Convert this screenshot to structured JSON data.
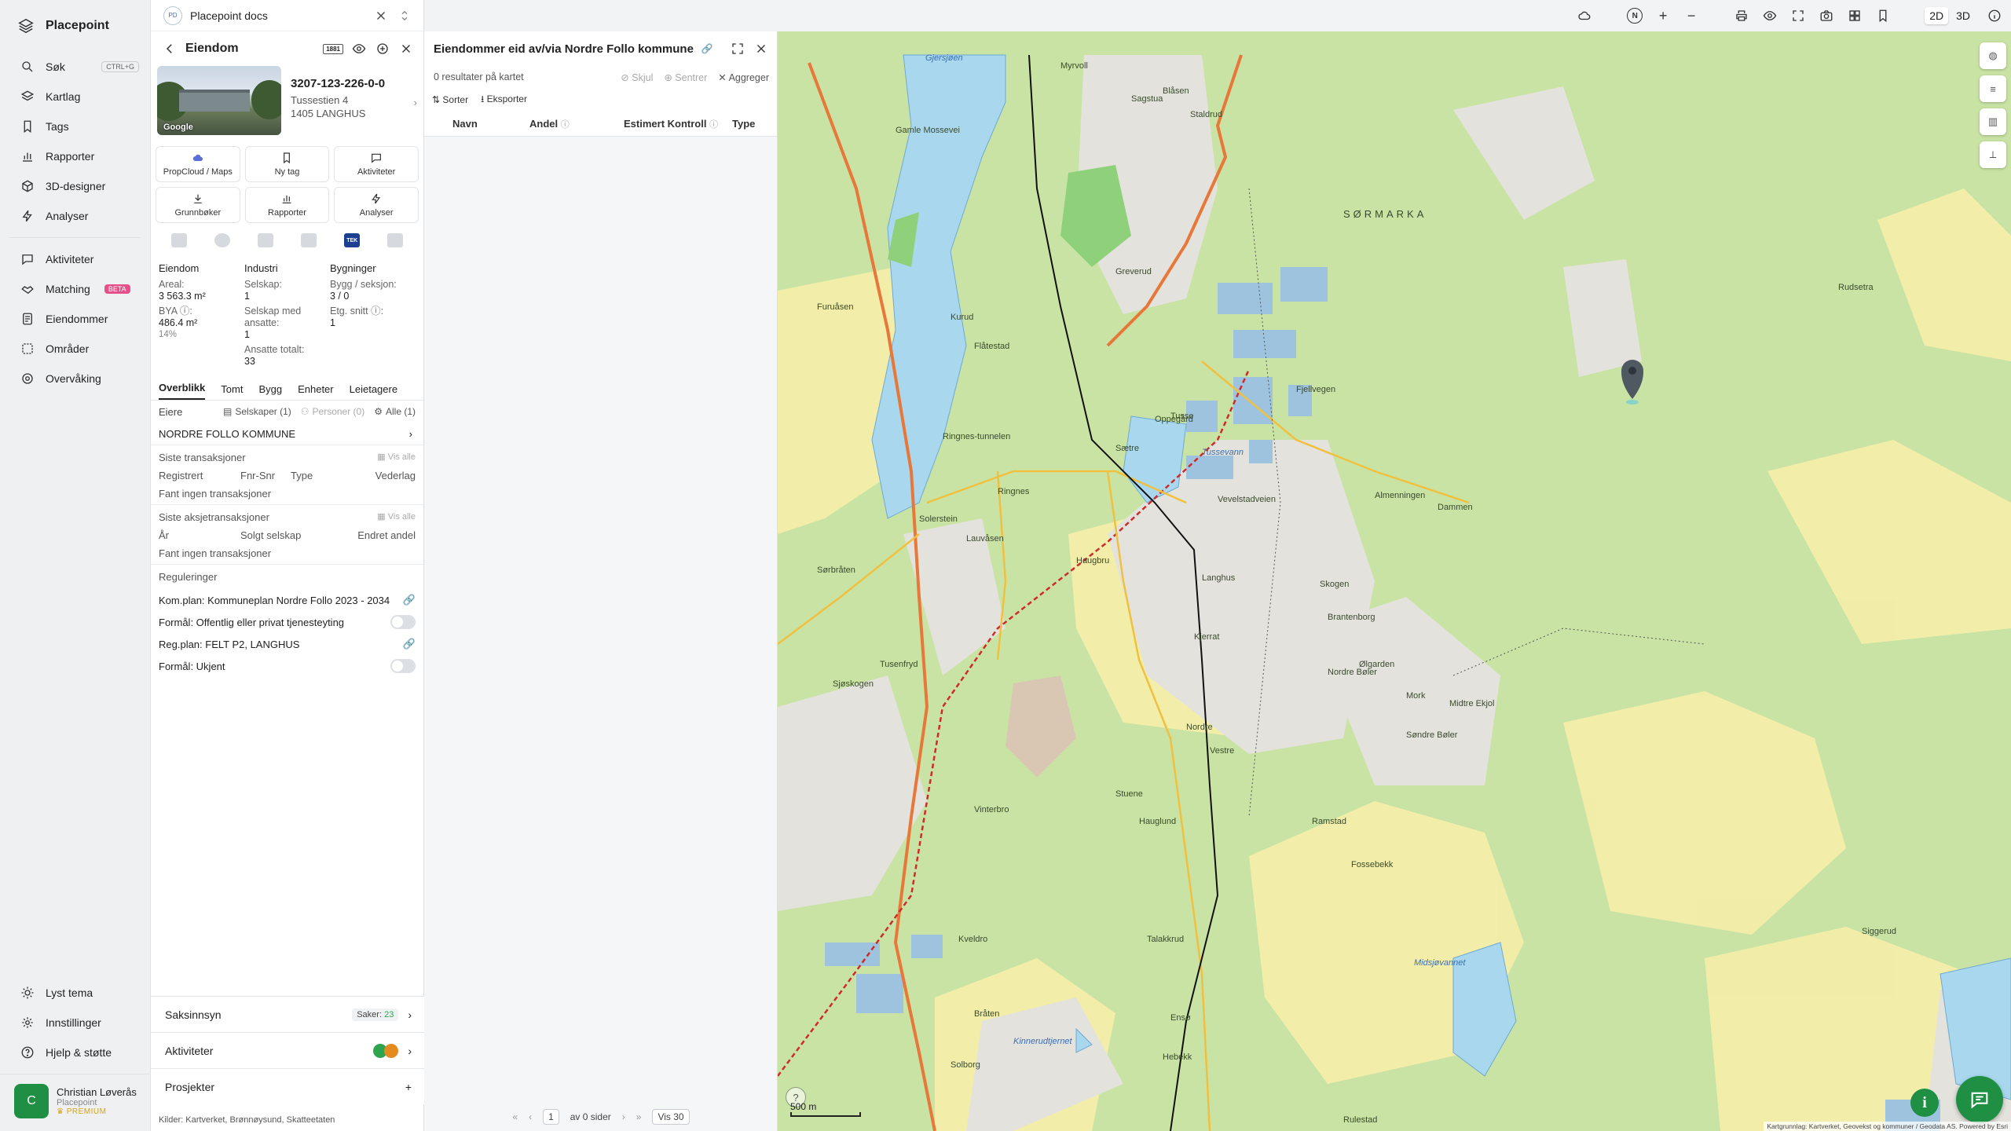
{
  "app": {
    "name": "Placepoint"
  },
  "nav": {
    "items": [
      {
        "label": "Søk",
        "shortcut": "CTRL+G"
      },
      {
        "label": "Kartlag"
      },
      {
        "label": "Tags"
      },
      {
        "label": "Rapporter"
      },
      {
        "label": "3D-designer"
      },
      {
        "label": "Analyser"
      },
      {
        "label": "Aktiviteter"
      },
      {
        "label": "Matching",
        "badge": "BETA"
      },
      {
        "label": "Eiendommer"
      },
      {
        "label": "Områder"
      },
      {
        "label": "Overvåking"
      }
    ],
    "bottom": [
      {
        "label": "Lyst tema"
      },
      {
        "label": "Innstillinger"
      },
      {
        "label": "Hjelp & støtte"
      }
    ],
    "user": {
      "initial": "C",
      "name": "Christian Løverås",
      "org": "Placepoint",
      "plan": "PREMIUM"
    }
  },
  "docsbar": {
    "logo": "PD",
    "title": "Placepoint docs"
  },
  "property": {
    "header": "Eiendom",
    "header_badge": "1881",
    "photo_credit": "Google",
    "id": "3207-123-226-0-0",
    "address_line1": "Tussestien 4",
    "address_line2": "1405 LANGHUS",
    "actions": [
      "PropCloud / Maps",
      "Ny tag",
      "Aktiviteter",
      "Grunnbøker",
      "Rapporter",
      "Analyser"
    ],
    "source_badge": "TEK",
    "stats": {
      "col1_header": "Eiendom",
      "col2_header": "Industri",
      "col3_header": "Bygninger",
      "areal_label": "Areal:",
      "areal_value": "3 563.3 m²",
      "bya_label": "BYA ⓘ:",
      "bya_value": "486.4 m²",
      "bya_pct": "14%",
      "selskap_label": "Selskap:",
      "selskap_value": "1",
      "selskap_ansatte_label": "Selskap med ansatte:",
      "selskap_ansatte_value": "1",
      "ansatte_label": "Ansatte totalt:",
      "ansatte_value": "33",
      "bygg_label": "Bygg / seksjon:",
      "bygg_value": "3 / 0",
      "etg_label": "Etg. snitt ⓘ:",
      "etg_value": "1"
    },
    "tabs": [
      "Overblikk",
      "Tomt",
      "Bygg",
      "Enheter",
      "Leietagere"
    ],
    "eiere": {
      "label": "Eiere",
      "f1": "Selskaper (1)",
      "f2": "Personer (0)",
      "f3": "Alle (1)",
      "owner": "NORDRE FOLLO KOMMUNE"
    },
    "transaksjoner": {
      "title": "Siste transaksjoner",
      "vis_alle": "Vis alle",
      "cols": [
        "Registrert",
        "Fnr-Snr",
        "Type",
        "Vederlag"
      ],
      "empty": "Fant ingen transaksjoner"
    },
    "aksjetransaksjoner": {
      "title": "Siste aksjetransaksjoner",
      "vis_alle": "Vis alle",
      "cols": [
        "År",
        "Solgt selskap",
        "Endret andel"
      ],
      "empty": "Fant ingen transaksjoner"
    },
    "reguleringer": {
      "title": "Reguleringer",
      "komplan": "Kom.plan: Kommuneplan Nordre Follo 2023 - 2034",
      "formal1": "Formål: Offentlig eller privat tjenesteyting",
      "regplan": "Reg.plan: FELT P2, LANGHUS",
      "formal2": "Formål: Ukjent"
    },
    "accordion": {
      "saksinnsyn": "Saksinnsyn",
      "saker_label": "Saker:",
      "saker_count": "23",
      "aktiviteter": "Aktiviteter",
      "prosjekter": "Prosjekter"
    },
    "kilder": {
      "label": "Kilder:",
      "sources": [
        "Kartverket,",
        "Brønnøysund,",
        "Skatteetaten"
      ]
    }
  },
  "results": {
    "title": "Eiendommer eid av/via Nordre Follo kommune",
    "count_text": "0 resultater på kartet",
    "skjul": "Skjul",
    "sentrer": "Sentrer",
    "aggreger": "Aggreger",
    "sorter": "Sorter",
    "eksporter": "Eksporter",
    "columns": [
      "Navn",
      "Andel",
      "Estimert Kontroll",
      "Type"
    ],
    "pager": {
      "page": "1",
      "of_text": "av 0 sider",
      "per_page": "Vis 30"
    }
  },
  "maptoolbar": {
    "north": "N",
    "mode_2d": "2D",
    "mode_3d": "3D"
  },
  "map": {
    "scale": "500 m",
    "attribution": "Kartgrunnlag: Kartverket, Geovekst og kommuner / Geodata AS. Powered by Esri",
    "help": "?",
    "labels": [
      {
        "t": "Gjersjøen",
        "w": true
      },
      {
        "t": "Gamle Mossevei"
      },
      {
        "t": "Myrvoll"
      },
      {
        "t": "Sagstua"
      },
      {
        "t": "Blåsen"
      },
      {
        "t": "Staldrud"
      },
      {
        "t": "SØRMARKA"
      },
      {
        "t": "Furuåsen"
      },
      {
        "t": "Kurud"
      },
      {
        "t": "Flåtestad"
      },
      {
        "t": "Greverud"
      },
      {
        "t": "Sjøskogen"
      },
      {
        "t": "Ringnes"
      },
      {
        "t": "Ringnes-tunnelen"
      },
      {
        "t": "Solerstein"
      },
      {
        "t": "Lauvåsen"
      },
      {
        "t": "Haugbru"
      },
      {
        "t": "Oppegård"
      },
      {
        "t": "Sætre"
      },
      {
        "t": "Tusse"
      },
      {
        "t": "Tussevann",
        "w": true
      },
      {
        "t": "Fjellvegen"
      },
      {
        "t": "Langhus"
      },
      {
        "t": "Nordre Bøler"
      },
      {
        "t": "Sørbråten"
      },
      {
        "t": "Tusenfryd"
      },
      {
        "t": "Vinterbro"
      },
      {
        "t": "Stuene"
      },
      {
        "t": "Hauglund"
      },
      {
        "t": "Nordre"
      },
      {
        "t": "Ramstad"
      },
      {
        "t": "Fossebekk"
      },
      {
        "t": "Kveldro"
      },
      {
        "t": "Talakkrud"
      },
      {
        "t": "Ensø"
      },
      {
        "t": "Solborg"
      },
      {
        "t": "Midsjøvannet",
        "w": true
      },
      {
        "t": "Bråten"
      },
      {
        "t": "Kinnerudtjernet",
        "w": true
      },
      {
        "t": "Siggerud"
      },
      {
        "t": "Kjerrat"
      },
      {
        "t": "Vevelstadveien"
      },
      {
        "t": "Rudsetra"
      },
      {
        "t": "Almenningen"
      },
      {
        "t": "Dammen"
      },
      {
        "t": "Skogen"
      },
      {
        "t": "Brantenborg"
      },
      {
        "t": "Ølgarden"
      },
      {
        "t": "Mork"
      },
      {
        "t": "Midtre Ekjol"
      },
      {
        "t": "Søndre Bøler"
      },
      {
        "t": "Vestre"
      },
      {
        "t": "Hebekk"
      },
      {
        "t": "Rulestad"
      }
    ]
  }
}
